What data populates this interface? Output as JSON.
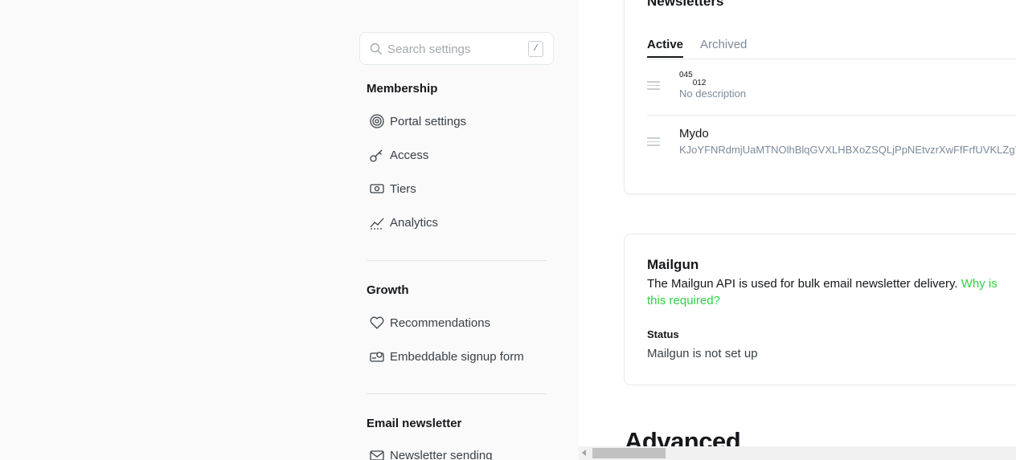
{
  "sidebar": {
    "search": {
      "placeholder": "Search settings",
      "shortcut": "/"
    },
    "groups": [
      {
        "title": "Membership",
        "items": [
          {
            "label": "Portal settings",
            "icon": "portal-icon"
          },
          {
            "label": "Access",
            "icon": "key-icon"
          },
          {
            "label": "Tiers",
            "icon": "money-icon"
          },
          {
            "label": "Analytics",
            "icon": "chart-icon"
          }
        ]
      },
      {
        "title": "Growth",
        "items": [
          {
            "label": "Recommendations",
            "icon": "heart-icon"
          },
          {
            "label": "Embeddable signup form",
            "icon": "signup-form-icon"
          }
        ]
      },
      {
        "title": "Email newsletter",
        "items": [
          {
            "label": "Newsletter sending",
            "icon": "mail-icon"
          }
        ]
      }
    ]
  },
  "main": {
    "newsletters": {
      "title": "Newsletters",
      "tabs": [
        {
          "label": "Active"
        },
        {
          "label": "Archived"
        }
      ],
      "items": [
        {
          "name_sup": "045",
          "name_sub": "012",
          "description": "No description"
        },
        {
          "name": "Mydo",
          "description": "KJoYFNRdmjUaMTNOlhBlqGVXLHBXoZSQLjPpNEtvzrXwFfFrfUVKLZgYLI"
        }
      ]
    },
    "mailgun": {
      "title": "Mailgun",
      "description": "The Mailgun API is used for bulk email newsletter delivery.",
      "link": "Why is this required?",
      "status_label": "Status",
      "status_value": "Mailgun is not set up"
    },
    "advanced_title": "Advanced"
  },
  "colors": {
    "accent_link": "#30cf43",
    "sidebar_bg": "#fafafa"
  }
}
